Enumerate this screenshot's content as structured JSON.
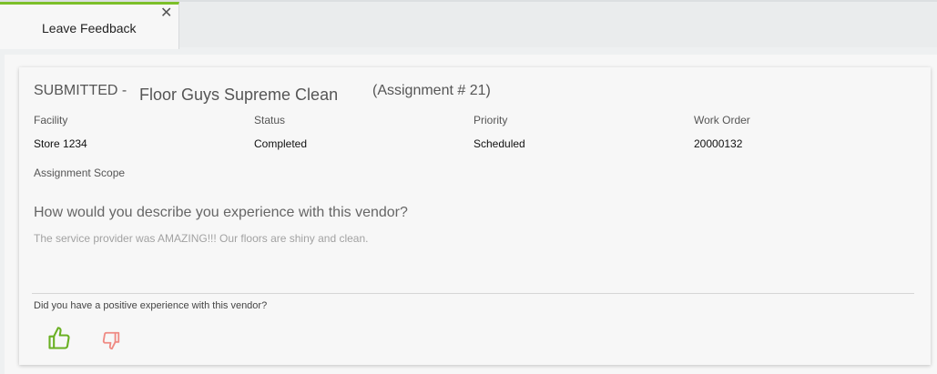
{
  "tab": {
    "label": "Leave Feedback",
    "close_glyph": "✕"
  },
  "header": {
    "status": "SUBMITTED -",
    "vendor": "Floor Guys Supreme Clean",
    "assignment": "(Assignment # 21)"
  },
  "fields": [
    {
      "label": "Facility",
      "value": "Store 1234"
    },
    {
      "label": "Status",
      "value": "Completed"
    },
    {
      "label": "Priority",
      "value": "Scheduled"
    },
    {
      "label": "Work Order",
      "value": "20000132"
    }
  ],
  "scope": {
    "label": "Assignment Scope"
  },
  "feedback": {
    "question": "How would you describe you experience with this vendor?",
    "answer": "The service provider was AMAZING!!! Our floors are shiny and clean."
  },
  "rating": {
    "question": "Did you have a positive experience with this vendor?",
    "thumbs_up_icon": "thumbs-up-icon",
    "thumbs_down_icon": "thumbs-down-icon",
    "positive_color": "#6ab023",
    "negative_color": "#ef8a83"
  },
  "colors": {
    "accent": "#7cbf2a"
  }
}
